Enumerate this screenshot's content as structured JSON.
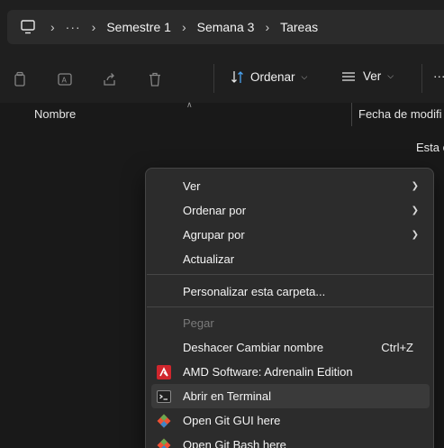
{
  "address_bar": {
    "overflow": "···",
    "crumbs": [
      "Semestre 1",
      "Semana 3",
      "Tareas"
    ]
  },
  "toolbar": {
    "sort_label": "Ordenar",
    "view_label": "Ver",
    "more_label": "···",
    "icons": [
      "copy-icon",
      "rename-icon",
      "share-icon",
      "delete-icon",
      "sort-icon",
      "view-icon"
    ]
  },
  "columns": {
    "name": "Nombre",
    "date": "Fecha de modifi"
  },
  "empty_message": "Esta c",
  "context_menu": {
    "items": [
      {
        "label": "Ver",
        "submenu": true
      },
      {
        "label": "Ordenar por",
        "submenu": true
      },
      {
        "label": "Agrupar por",
        "submenu": true
      },
      {
        "label": "Actualizar"
      },
      {
        "label": "Personalizar esta carpeta..."
      },
      {
        "label": "Pegar",
        "disabled": true
      },
      {
        "label": "Deshacer Cambiar nombre",
        "accelerator": "Ctrl+Z"
      },
      {
        "label": "AMD Software: Adrenalin Edition",
        "icon": "amd-icon"
      },
      {
        "label": "Abrir en Terminal",
        "icon": "terminal-icon",
        "hovered": true
      },
      {
        "label": "Open Git GUI here",
        "icon": "git-gui-icon"
      },
      {
        "label": "Open Git Bash here",
        "icon": "git-bash-icon"
      }
    ]
  },
  "colors": {
    "background": "#191919",
    "menu_background": "#2c2c2c",
    "amd_red": "#d0262d",
    "git_orange": "#f05133"
  }
}
